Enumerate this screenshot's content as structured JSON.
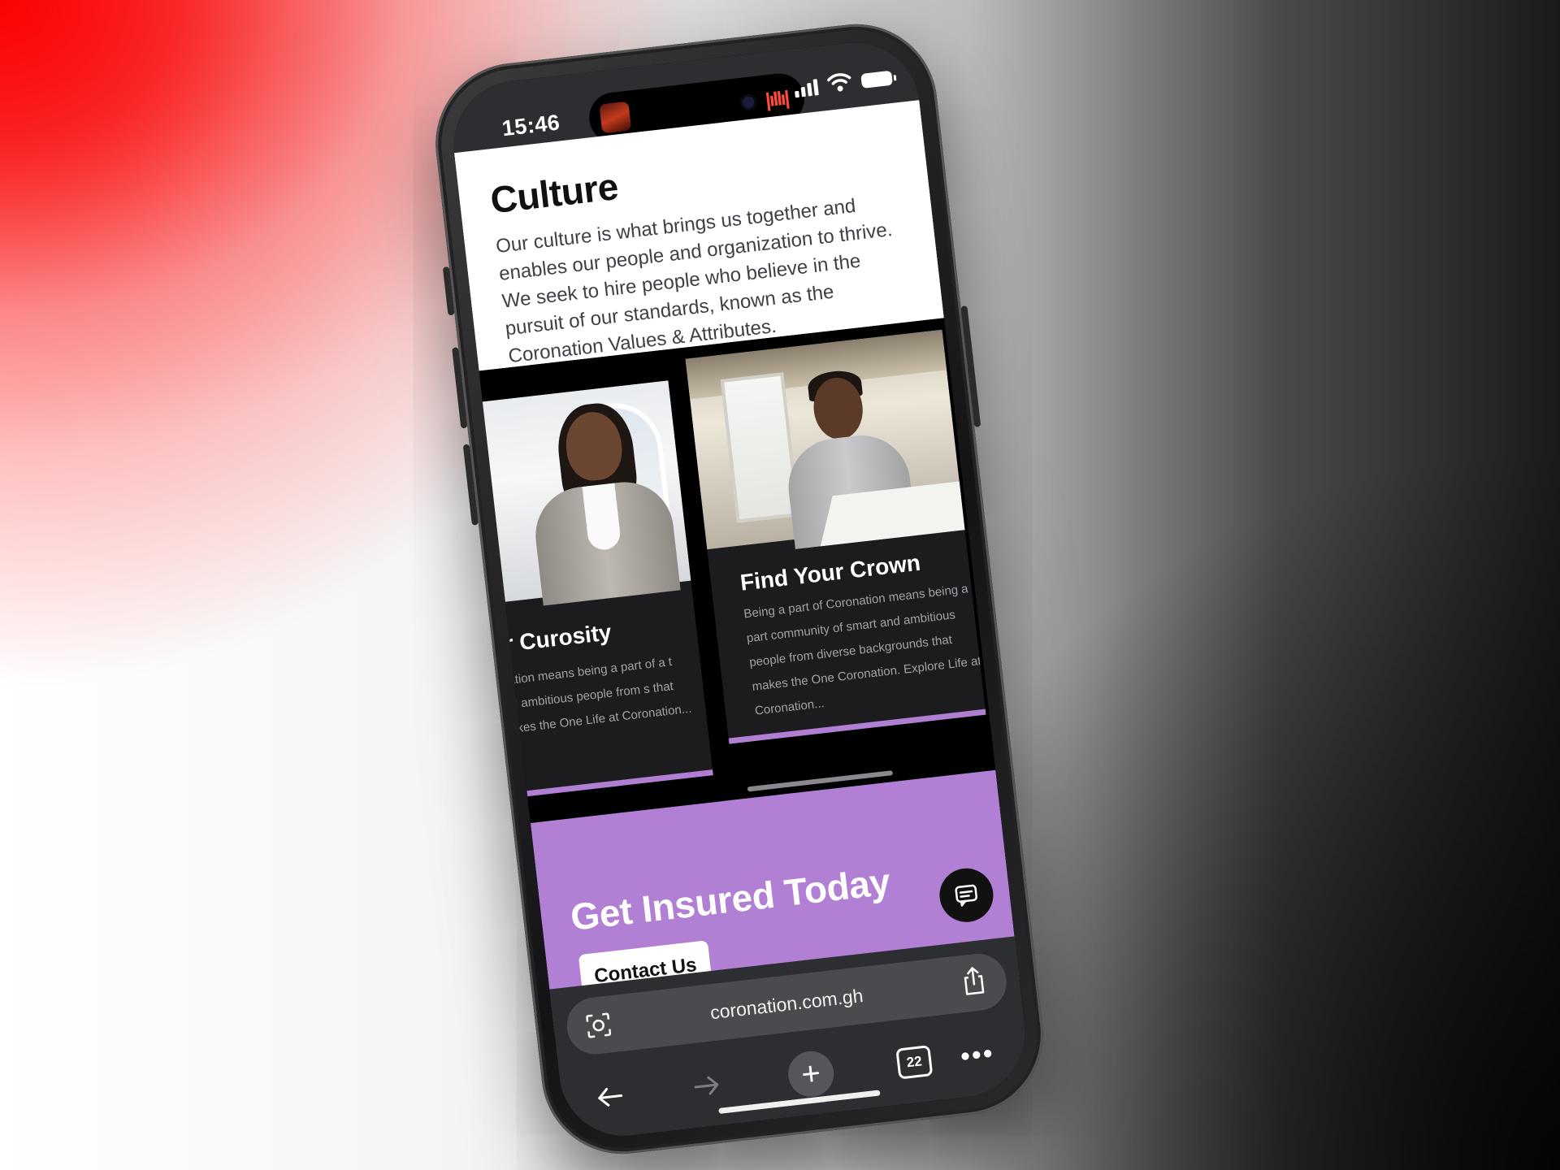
{
  "status_bar": {
    "time": "15:46"
  },
  "culture": {
    "heading": "Culture",
    "body": "Our culture is what brings us together and enables our people and organization to thrive. We seek to hire people who believe in the pursuit of our standards, known as the Coronation Values & Attributes."
  },
  "cards": [
    {
      "title": "ur Curosity",
      "description": "onation means being a part of a t and ambitious people from s that makes the One Life at Coronation..."
    },
    {
      "title": "Find Your Crown",
      "description": "Being a part of Coronation means being a part community of smart and ambitious people from diverse backgrounds that makes the One Coronation. Explore Life at Coronation..."
    }
  ],
  "cta": {
    "heading": "Get Insured Today",
    "button_label": "Contact Us"
  },
  "browser": {
    "url": "coronation.com.gh",
    "tab_count": "22",
    "more_label": "•••",
    "new_tab_label": "+"
  },
  "colors": {
    "accent_purple": "#b17fd4",
    "card_bg": "#1c1c1f",
    "browser_chrome": "#2d2e31"
  },
  "icons": [
    "lens-icon",
    "share-icon",
    "back-arrow-icon",
    "forward-arrow-icon",
    "plus-icon",
    "tabs-icon",
    "more-icon",
    "chat-icon",
    "signal-icon",
    "wifi-icon",
    "battery-icon"
  ]
}
